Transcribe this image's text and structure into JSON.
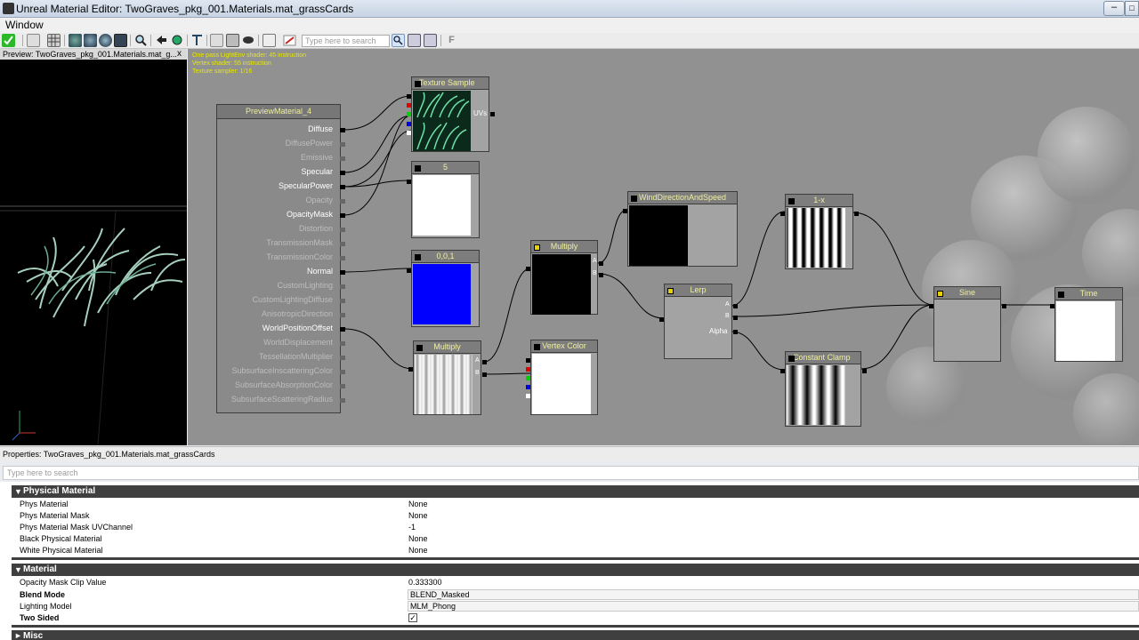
{
  "window": {
    "title": "Unreal Material Editor: TwoGraves_pkg_001.Materials.mat_grassCards"
  },
  "menu": {
    "window": "Window"
  },
  "toolbar": {
    "search_placeholder": "Type here to search",
    "f_label": "F"
  },
  "preview": {
    "title": "Preview: TwoGraves_pkg_001.Materials.mat_g...",
    "close": "x"
  },
  "stats": {
    "line1": "One pass LightEnv shader: 45 instruction",
    "line2": "Vertex shader: 55 instruction",
    "line3": "Texture sampler: 1/16"
  },
  "graph": {
    "material_node": {
      "title": "PreviewMaterial_4",
      "inputs": [
        "Diffuse",
        "DiffusePower",
        "Emissive",
        "Specular",
        "SpecularPower",
        "Opacity",
        "OpacityMask",
        "Distortion",
        "TransmissionMask",
        "TransmissionColor",
        "Normal",
        "CustomLighting",
        "CustomLightingDiffuse",
        "AnisotropicDirection",
        "WorldPositionOffset",
        "WorldDisplacement",
        "TessellationMultiplier",
        "SubsurfaceInscatteringColor",
        "SubsurfaceAbsorptionColor",
        "SubsurfaceScatteringRadius"
      ],
      "connected": [
        true,
        false,
        false,
        true,
        true,
        false,
        true,
        false,
        false,
        false,
        true,
        false,
        false,
        false,
        true,
        false,
        false,
        false,
        false,
        false
      ]
    },
    "texture_sample": {
      "title": "Texture Sample",
      "output": "UVs"
    },
    "const_5": {
      "title": "5"
    },
    "const_normal": {
      "title": "0,0,1"
    },
    "multiply_1": {
      "title": "Multiply",
      "pin_a": "A",
      "pin_b": "B"
    },
    "multiply_2": {
      "title": "Multiply",
      "pin_a": "A",
      "pin_b": "B"
    },
    "vertex_color": {
      "title": "Vertex Color"
    },
    "wind": {
      "title": "WindDirectionAndSpeed"
    },
    "lerp": {
      "title": "Lerp",
      "pin_a": "A",
      "pin_b": "B",
      "pin_alpha": "Alpha"
    },
    "one_minus": {
      "title": "1-x"
    },
    "constant_clamp": {
      "title": "Constant Clamp"
    },
    "sine": {
      "title": "Sine"
    },
    "time": {
      "title": "Time"
    }
  },
  "properties": {
    "header": "Properties: TwoGraves_pkg_001.Materials.mat_grassCards",
    "search_placeholder": "Type here to search",
    "categories": {
      "physical": {
        "label": "Physical Material",
        "rows": [
          {
            "name": "Phys Material",
            "value": "None"
          },
          {
            "name": "Phys Material Mask",
            "value": "None"
          },
          {
            "name": "Phys Material Mask UVChannel",
            "value": "-1"
          },
          {
            "name": "Black Physical Material",
            "value": "None"
          },
          {
            "name": "White Physical Material",
            "value": "None"
          }
        ]
      },
      "material": {
        "label": "Material",
        "rows": [
          {
            "name": "Opacity Mask Clip Value",
            "value": "0.333300"
          },
          {
            "name": "Blend Mode",
            "value": "BLEND_Masked"
          },
          {
            "name": "Lighting Model",
            "value": "MLM_Phong"
          },
          {
            "name": "Two Sided",
            "value": true
          }
        ]
      },
      "misc": {
        "label": "Misc"
      }
    }
  }
}
